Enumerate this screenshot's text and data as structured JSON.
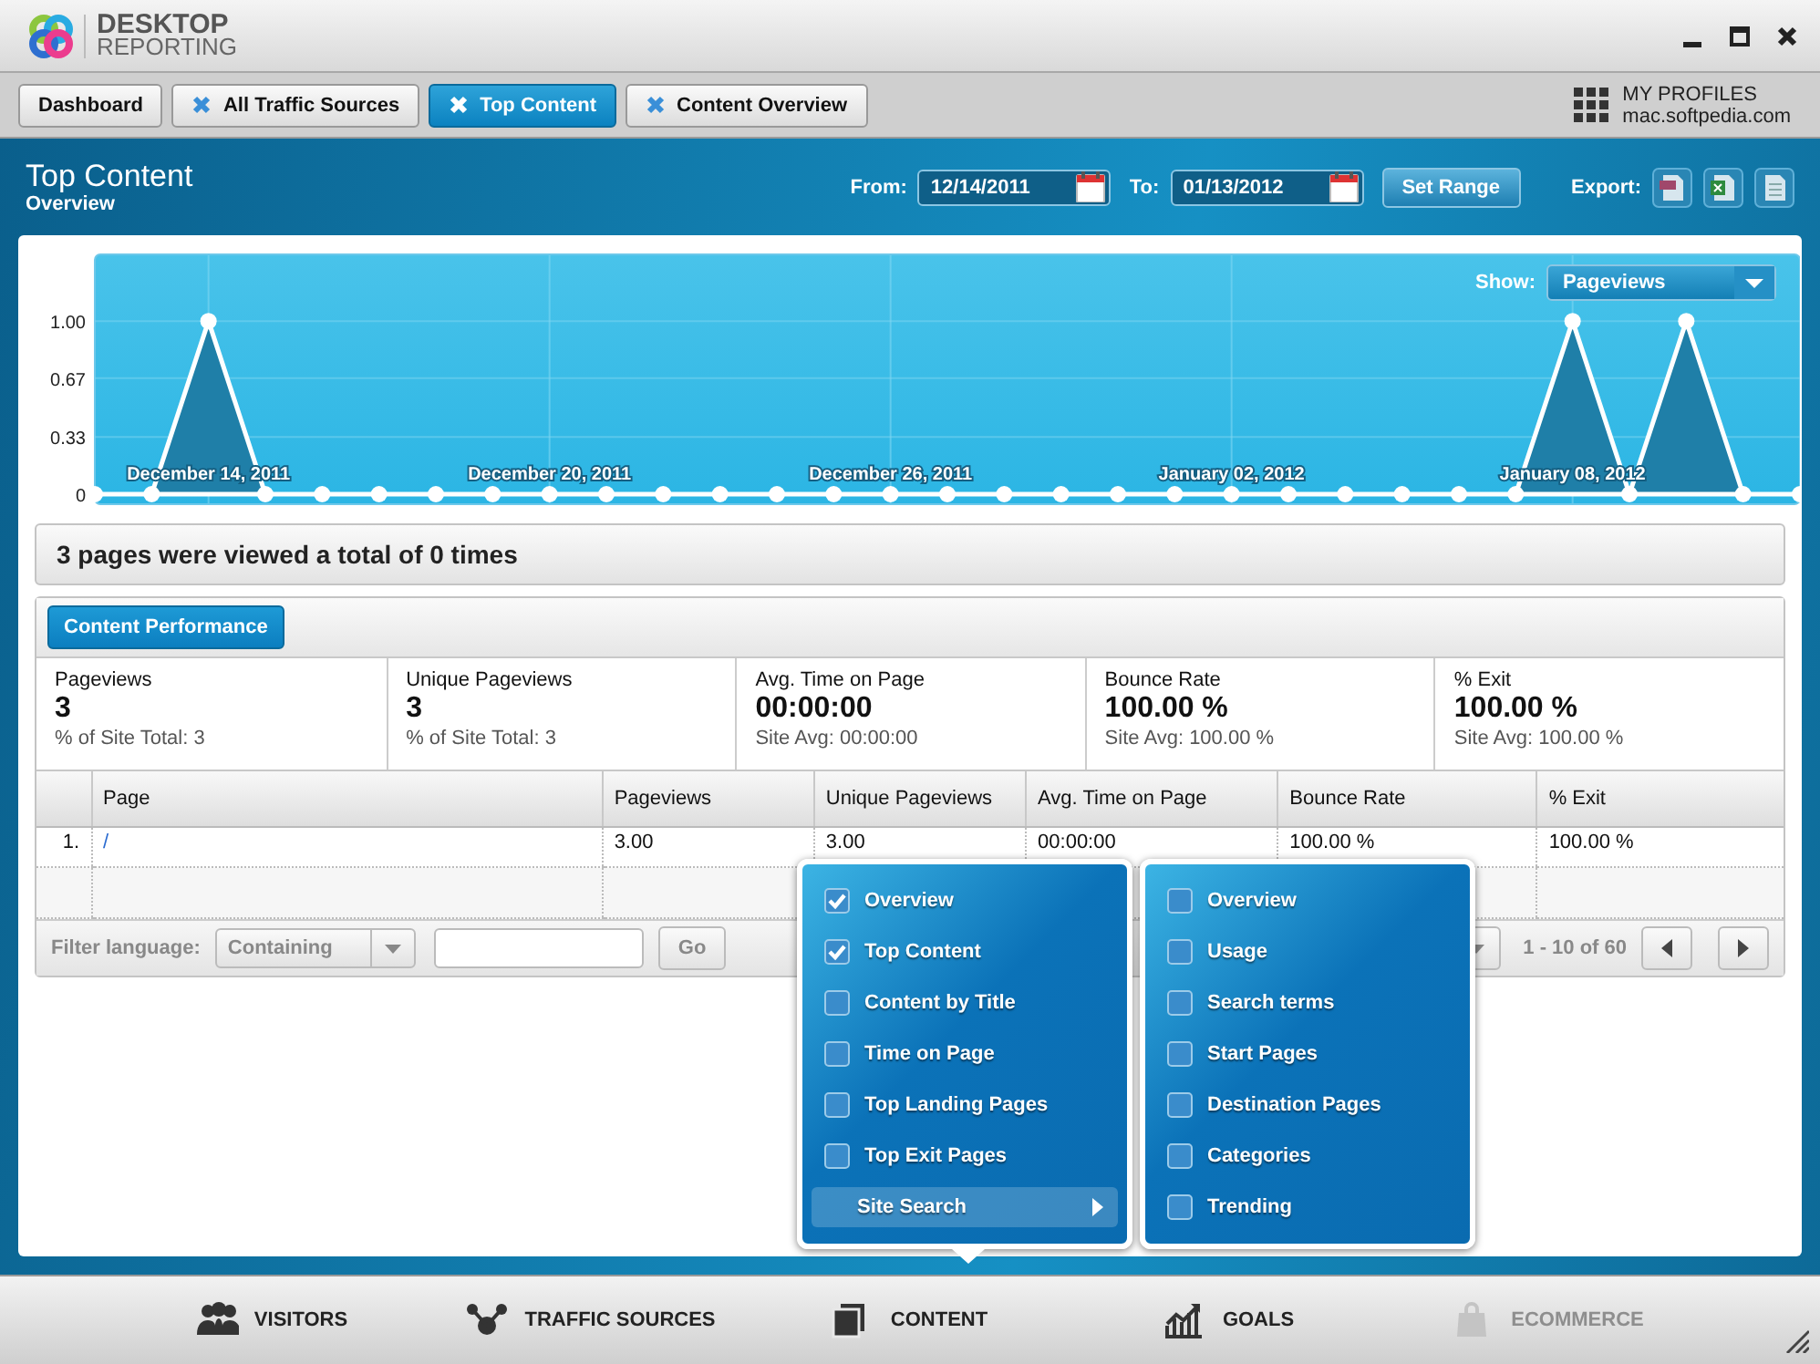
{
  "window": {
    "logo_top": "DESKTOP",
    "logo_bottom": "REPORTING"
  },
  "tabs": [
    {
      "label": "Dashboard",
      "closable": false,
      "selected": false
    },
    {
      "label": "All Traffic Sources",
      "closable": true,
      "selected": false
    },
    {
      "label": "Top Content",
      "closable": true,
      "selected": true
    },
    {
      "label": "Content Overview",
      "closable": true,
      "selected": false
    }
  ],
  "profile": {
    "title": "MY PROFILES",
    "site": "mac.softpedia.com"
  },
  "header": {
    "title": "Top Content",
    "subtitle": "Overview",
    "from_label": "From:",
    "from": "12/14/2011",
    "to_label": "To:",
    "to": "01/13/2012",
    "set_range": "Set Range",
    "export_label": "Export:"
  },
  "chart": {
    "show_label": "Show:",
    "show_value": "Pageviews",
    "chart_data": {
      "type": "area",
      "grid": true,
      "yticks": [
        0,
        {
          "value": 0.33,
          "label": "0.33"
        },
        {
          "value": 0.67,
          "label": "0.67"
        },
        {
          "value": 1,
          "label": "1.00"
        }
      ],
      "ylim": [
        0,
        1.38
      ],
      "categories": [
        null,
        null,
        "December 14, 2011",
        null,
        null,
        null,
        null,
        null,
        "December 20, 2011",
        null,
        null,
        null,
        null,
        null,
        "December 26, 2011",
        null,
        null,
        null,
        null,
        null,
        "January 02, 2012",
        null,
        null,
        null,
        null,
        null,
        "January 08, 2012",
        null,
        null,
        null,
        null
      ],
      "values": [
        0,
        0,
        1,
        0,
        0,
        0,
        0,
        0,
        0,
        0,
        0,
        0,
        0,
        0,
        0,
        0,
        0,
        0,
        0,
        0,
        0,
        0,
        0,
        0,
        0,
        0,
        1,
        0,
        1,
        0,
        0
      ]
    }
  },
  "summary": "3 pages were viewed a total of 0 times",
  "section_button": "Content Performance",
  "metrics": [
    {
      "name": "Pageviews",
      "value": "3",
      "note": "% of Site Total: 3"
    },
    {
      "name": "Unique Pageviews",
      "value": "3",
      "note": "% of Site Total: 3"
    },
    {
      "name": "Avg. Time on Page",
      "value": "00:00:00",
      "note": "Site Avg: 00:00:00"
    },
    {
      "name": "Bounce Rate",
      "value": "100.00 %",
      "note": "Site Avg: 100.00 %"
    },
    {
      "name": "% Exit",
      "value": "100.00 %",
      "note": "Site Avg: 100.00 %"
    }
  ],
  "table": {
    "columns": [
      "Page",
      "Pageviews",
      "Unique Pageviews",
      "Avg. Time on Page",
      "Bounce Rate",
      "% Exit"
    ],
    "rows": [
      {
        "number": "1.",
        "cells": [
          "/",
          "3.00",
          "3.00",
          "00:00:00",
          "100.00 %",
          "100.00 %"
        ]
      }
    ]
  },
  "footer": {
    "filter_label": "Filter language:",
    "filter_mode": "Containing",
    "go": "Go",
    "range": "1 - 10 of 60"
  },
  "menu": {
    "left": [
      {
        "label": "Overview",
        "kind": "check",
        "checked": true
      },
      {
        "label": "Top Content",
        "kind": "check",
        "checked": true
      },
      {
        "label": "Content by Title",
        "kind": "check",
        "checked": false
      },
      {
        "label": "Time on Page",
        "kind": "check",
        "checked": false
      },
      {
        "label": "Top Landing Pages",
        "kind": "check",
        "checked": false
      },
      {
        "label": "Top Exit Pages",
        "kind": "check",
        "checked": false
      },
      {
        "label": "Site Search",
        "kind": "submenu",
        "selected": true
      }
    ],
    "right": [
      {
        "label": "Overview",
        "kind": "check",
        "checked": false
      },
      {
        "label": "Usage",
        "kind": "check",
        "checked": false
      },
      {
        "label": "Search terms",
        "kind": "check",
        "checked": false
      },
      {
        "label": "Start Pages",
        "kind": "check",
        "checked": false
      },
      {
        "label": "Destination Pages",
        "kind": "check",
        "checked": false
      },
      {
        "label": "Categories",
        "kind": "check",
        "checked": false
      },
      {
        "label": "Trending",
        "kind": "check",
        "checked": false
      }
    ]
  },
  "nav": [
    {
      "label": "VISITORS",
      "disabled": false
    },
    {
      "label": "TRAFFIC SOURCES",
      "disabled": false
    },
    {
      "label": "CONTENT",
      "disabled": false
    },
    {
      "label": "GOALS",
      "disabled": false
    },
    {
      "label": "ECOMMERCE",
      "disabled": true
    }
  ]
}
